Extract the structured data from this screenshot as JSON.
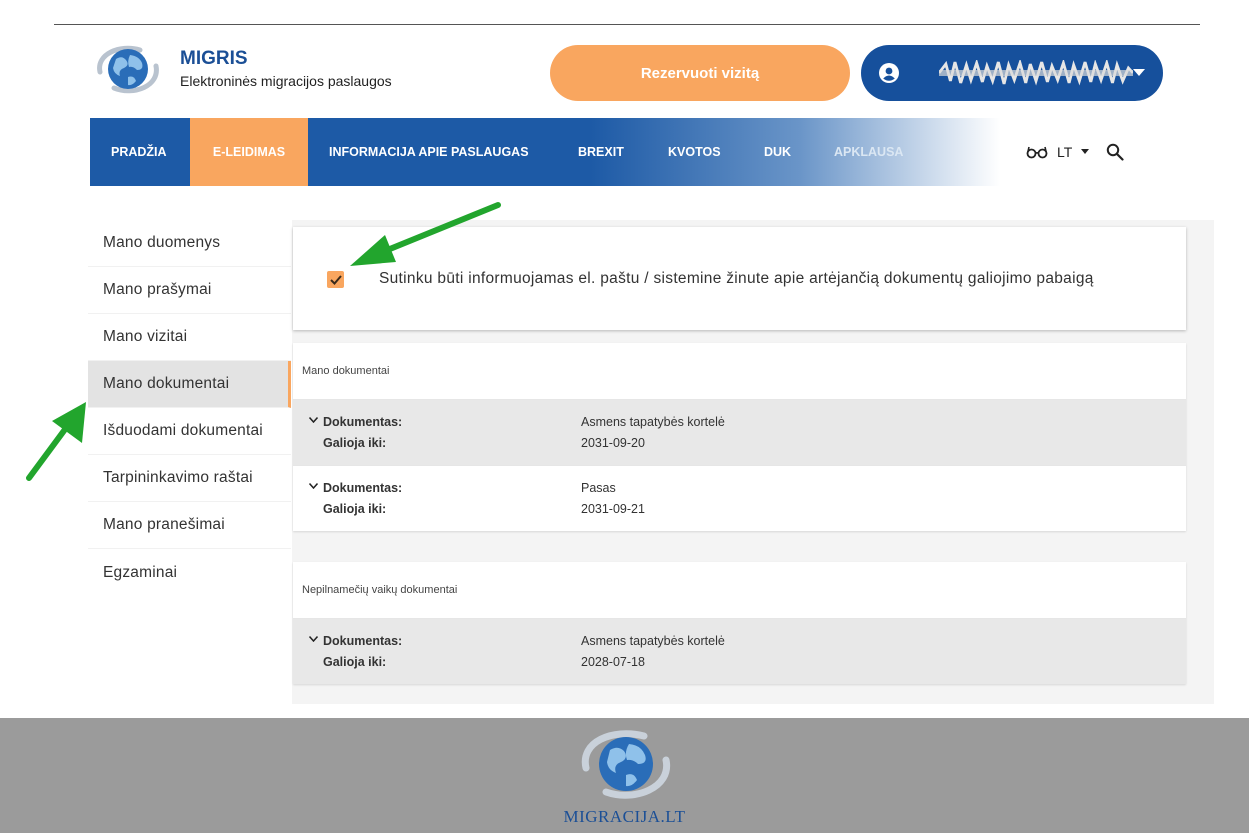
{
  "header": {
    "brand_title": "MIGRIS",
    "brand_subtitle": "Elektroninės migracijos paslaugos",
    "reserve_button": "Rezervuoti vizitą",
    "user_name": "",
    "logo_icon": "globe-logo-icon",
    "user_icon": "account-circle-icon"
  },
  "nav": {
    "items": [
      {
        "label": "PRADŽIA"
      },
      {
        "label": "E-LEIDIMAS"
      },
      {
        "label": "INFORMACIJA APIE PASLAUGAS"
      },
      {
        "label": "BREXIT"
      },
      {
        "label": "KVOTOS"
      },
      {
        "label": "DUK"
      },
      {
        "label": "APKLAUSA"
      }
    ],
    "active": "E-LEIDIMAS",
    "language": "LT",
    "tools": [
      "glasses-icon",
      "chevron-down-icon",
      "search-icon"
    ]
  },
  "sidebar": {
    "items": [
      {
        "label": "Mano duomenys"
      },
      {
        "label": "Mano prašymai"
      },
      {
        "label": "Mano vizitai"
      },
      {
        "label": "Mano dokumentai"
      },
      {
        "label": "Išduodami dokumentai"
      },
      {
        "label": "Tarpininkavimo raštai"
      },
      {
        "label": "Mano pranešimai"
      },
      {
        "label": "Egzaminai"
      }
    ],
    "active": "Mano dokumentai"
  },
  "consent": {
    "checked": true,
    "text": "Sutinku būti informuojamas el. paštu / sistemine žinute apie artėjančią dokumentų galiojimo pabaigą"
  },
  "sections": [
    {
      "title": "Mano dokumentai",
      "rows": [
        {
          "label_document": "Dokumentas:",
          "value_document": "Asmens tapatybės kortelė",
          "label_valid": "Galioja iki:",
          "value_valid": "2031-09-20"
        },
        {
          "label_document": "Dokumentas:",
          "value_document": "Pasas",
          "label_valid": "Galioja iki:",
          "value_valid": "2031-09-21"
        }
      ]
    },
    {
      "title": "Nepilnamečių vaikų dokumentai",
      "rows": [
        {
          "label_document": "Dokumentas:",
          "value_document": "Asmens tapatybės kortelė",
          "label_valid": "Galioja iki:",
          "value_valid": "2028-07-18"
        }
      ]
    }
  ],
  "footer": {
    "site": "MIGRACIJA.LT"
  },
  "colors": {
    "primary_blue": "#1d5aa6",
    "accent_orange": "#f9a65f",
    "annotation_green": "#22a52d",
    "footer_gray": "#9b9b9b"
  }
}
